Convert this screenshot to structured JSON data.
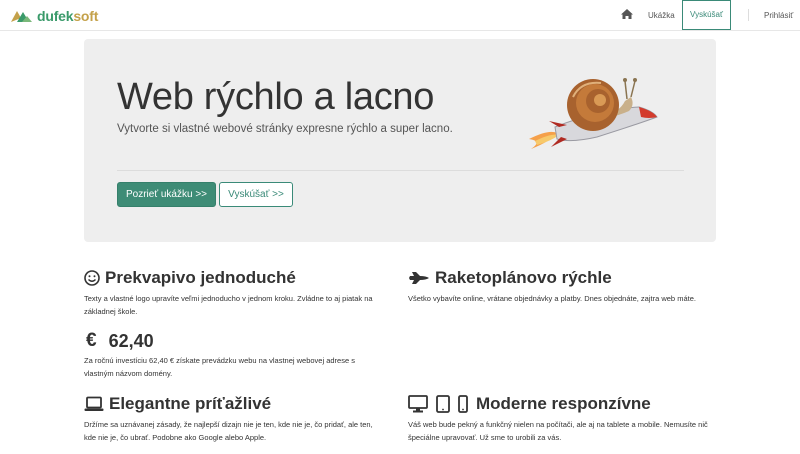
{
  "brand": {
    "name_part1": "dufek",
    "name_part2": "soft",
    "logo_icon": "dufeksoft-logo",
    "accent": "#3a9a6a",
    "accent2": "#c4a14a"
  },
  "nav": {
    "home_icon": "home-icon",
    "demo_label": "Ukážka",
    "try_label": "Vyskúšať",
    "login_label": "Prihlásiť"
  },
  "hero": {
    "title": "Web rýchlo a lacno",
    "subtitle": "Vytvorte si vlastné webové stránky expresne rýchlo a super lacno.",
    "primary_button": "Pozrieť ukážku >>",
    "secondary_button": "Vyskúšať >>",
    "image_icon": "snail-rocket-illustration"
  },
  "features": [
    {
      "icon": "smile-icon",
      "title": "Prekvapivo jednoduché",
      "text": "Texty a vlastné logo upravíte veľmi jednoducho v jednom kroku. Zvládne to aj piatak na základnej škole."
    },
    {
      "icon": "space-shuttle-icon",
      "title": "Raketoplánovo rýchle",
      "text": "Všetko vybavíte online, vrátane objednávky a platby. Dnes objednáte, zajtra web máte."
    },
    {
      "icon": "euro-icon",
      "title": "62,40",
      "text": "Za ročnú investíciu 62,40 € získate prevádzku webu na vlastnej webovej adrese s vlastným názvom domény."
    },
    {
      "icon": "laptop-icon",
      "title": "Elegantne príťažlivé",
      "text": "Držíme sa uznávanej zásady, že najlepší dizajn nie je ten, kde nie je, čo pridať, ale ten, kde nie je, čo ubrať. Podobne ako Google alebo Apple."
    },
    {
      "icon": "devices-icon",
      "title": "Moderne responzívne",
      "text": "Váš web bude pekný a funkčný nielen na počítači, ale aj na tablete a mobile. Nemusíte nič špeciálne upravovať. Už sme to urobili za vás."
    }
  ],
  "colors": {
    "primary": "#3e8c76",
    "jumbotron_bg": "#eeeeee",
    "text": "#333333"
  }
}
